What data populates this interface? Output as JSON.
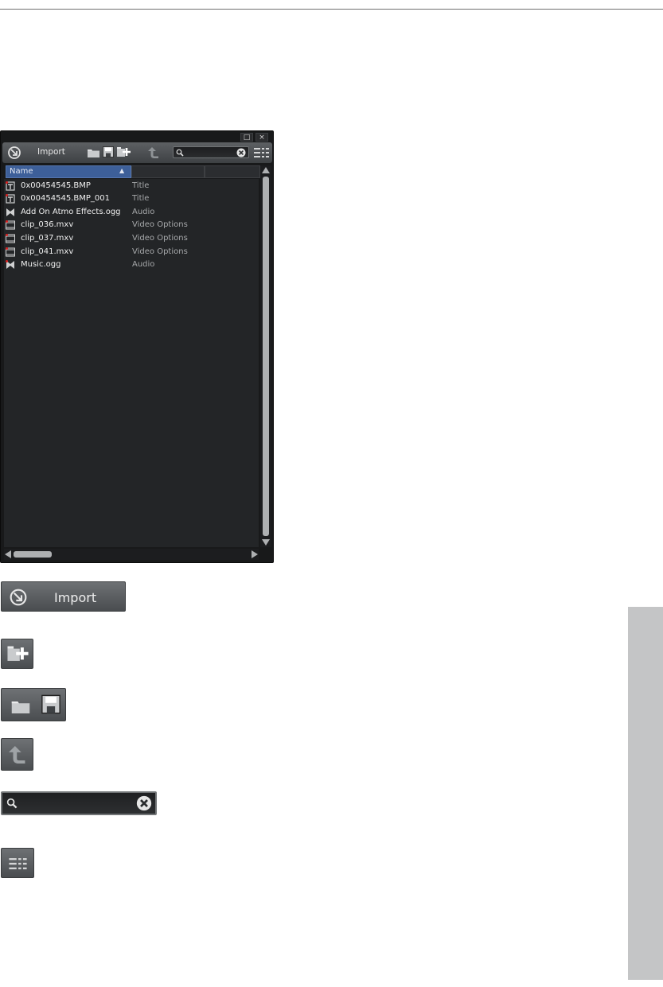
{
  "toolbar": {
    "import_label": "Import",
    "search": {
      "placeholder": ""
    }
  },
  "window_buttons": {
    "maximize": "□",
    "close": "×"
  },
  "columns": {
    "name": "Name",
    "sort_indicator": "▲"
  },
  "files": [
    {
      "name": "0x00454545.BMP",
      "type": "Title",
      "icon": "title-clip-icon"
    },
    {
      "name": "0x00454545.BMP_001",
      "type": "Title",
      "icon": "title-clip-icon"
    },
    {
      "name": "Add On Atmo Effects.ogg",
      "type": "Audio",
      "icon": "audio-icon"
    },
    {
      "name": "clip_036.mxv",
      "type": "Video Options",
      "icon": "video-clip-icon"
    },
    {
      "name": "clip_037.mxv",
      "type": "Video Options",
      "icon": "video-clip-icon"
    },
    {
      "name": "clip_041.mxv",
      "type": "Video Options",
      "icon": "video-clip-icon"
    },
    {
      "name": "Music.ogg",
      "type": "Audio",
      "icon": "audio-icon"
    }
  ],
  "enlarged": {
    "import_label": "Import"
  },
  "colors": {
    "accent": "#3d5f99",
    "panel": "#232527",
    "marker": "#d81e1e"
  }
}
